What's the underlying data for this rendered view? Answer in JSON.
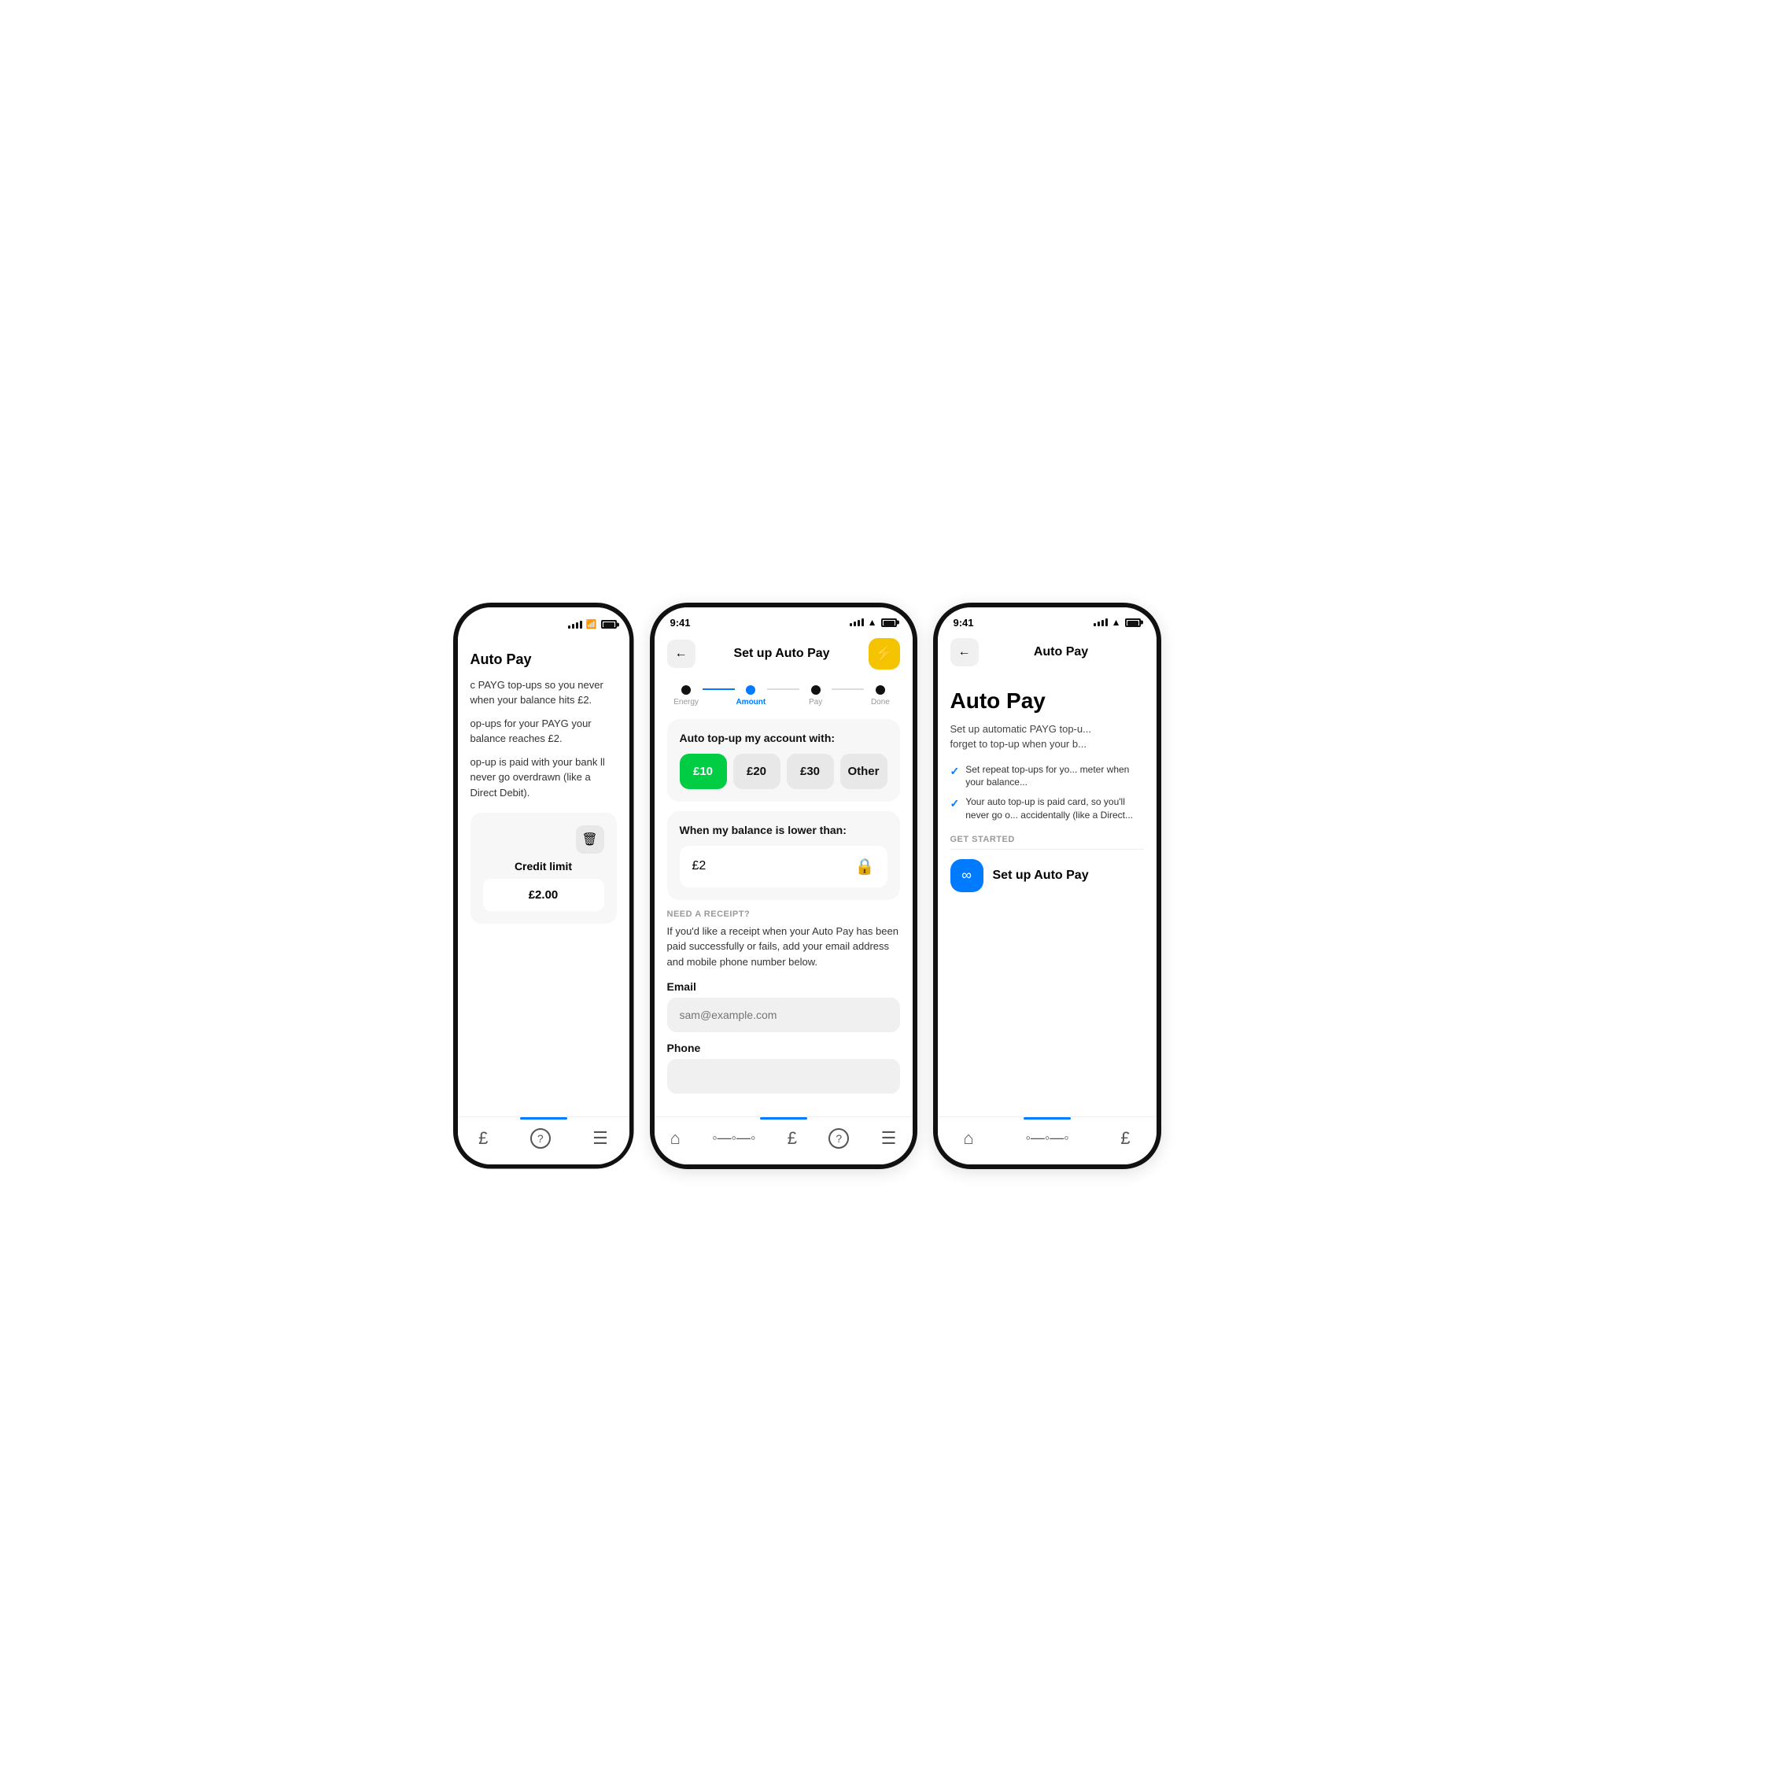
{
  "left_phone": {
    "page_title": "Auto Pay",
    "text1": "c PAYG top-ups so you never when your balance hits £2.",
    "text2": "op-ups for your PAYG your balance reaches £2.",
    "text3": "op-up is paid with your bank ll never go overdrawn (like a Direct Debit).",
    "credit_label": "Credit limit",
    "credit_value": "£2.00",
    "nav_items": [
      "£",
      "?",
      "≡"
    ]
  },
  "center_phone": {
    "time": "9:41",
    "nav_title": "Set up Auto Pay",
    "back_label": "←",
    "action_icon": "⚡",
    "steps": [
      {
        "label": "Energy",
        "state": "filled"
      },
      {
        "label": "Amount",
        "state": "active"
      },
      {
        "label": "Pay",
        "state": "normal"
      },
      {
        "label": "Done",
        "state": "normal"
      }
    ],
    "topup_title": "Auto top-up my account with:",
    "amount_options": [
      {
        "label": "£10",
        "selected": true
      },
      {
        "label": "£20",
        "selected": false
      },
      {
        "label": "£30",
        "selected": false
      },
      {
        "label": "Other",
        "selected": false
      }
    ],
    "balance_title": "When my balance is lower than:",
    "balance_value": "£2",
    "receipt_section": "NEED A RECEIPT?",
    "receipt_desc": "If you'd like a receipt when your Auto Pay has been paid successfully or fails, add your email address and mobile phone number below.",
    "email_label": "Email",
    "email_placeholder": "sam@example.com",
    "phone_label": "Phone",
    "nav_items": [
      "🏠",
      "◦◦◦",
      "£",
      "?",
      "≡"
    ]
  },
  "right_phone": {
    "time": "9:41",
    "nav_title": "Auto Pay",
    "back_label": "←",
    "page_title": "Auto Pay",
    "subtitle": "Set up automatic PAYG top-u... forget to top-up when your b...",
    "check_items": [
      "Set repeat top-ups for yo... meter when your balance...",
      "Your auto top-up is paid card, so you'll never go o... accidentally (like a Direct..."
    ],
    "get_started_label": "GET STARTED",
    "setup_btn_label": "Set up Auto Pay",
    "nav_items": [
      "🏠",
      "◦◦◦",
      "£"
    ]
  }
}
